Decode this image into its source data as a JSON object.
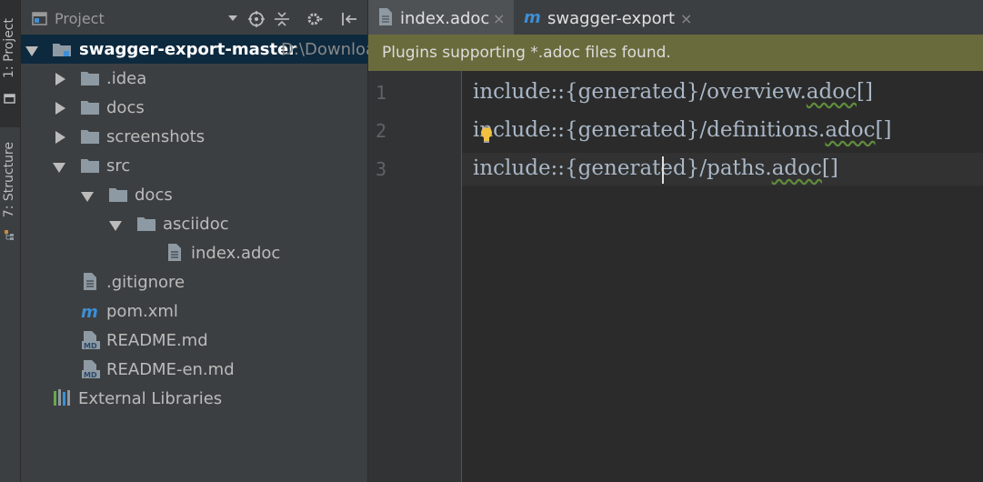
{
  "toolstrip": {
    "project_tab": "1: Project",
    "structure_tab": "7: Structure"
  },
  "project_panel": {
    "title": "Project",
    "root": {
      "name": "swagger-export-master",
      "path": "D:\\Downloa"
    },
    "items": [
      {
        "label": ".idea"
      },
      {
        "label": "docs"
      },
      {
        "label": "screenshots"
      },
      {
        "label": "src"
      },
      {
        "label": "docs"
      },
      {
        "label": "asciidoc"
      },
      {
        "label": "index.adoc"
      },
      {
        "label": ".gitignore"
      },
      {
        "label": "pom.xml"
      },
      {
        "label": "README.md"
      },
      {
        "label": "README-en.md"
      },
      {
        "label": "External Libraries"
      }
    ]
  },
  "editor": {
    "tabs": [
      {
        "label": "index.adoc",
        "active": true
      },
      {
        "label": "swagger-export",
        "active": false
      }
    ],
    "close_glyph": "×",
    "banner": "Plugins supporting *.adoc files found.",
    "line_numbers": [
      "1",
      "2",
      "3"
    ],
    "lines": [
      {
        "pre": "include::{generated}/overview.",
        "squig": "adoc",
        "post": "[]"
      },
      {
        "pre": "include::{generated}/definitions.",
        "squig": "adoc",
        "post": "[]"
      },
      {
        "pre": "include::{generated}/paths.",
        "squig": "adoc",
        "post": "[]"
      }
    ]
  },
  "colors": {
    "selection": "#0d293e",
    "banner": "#6a6b3c",
    "folder": "#8e9aa3",
    "maven_m": "#3d8fd6"
  }
}
